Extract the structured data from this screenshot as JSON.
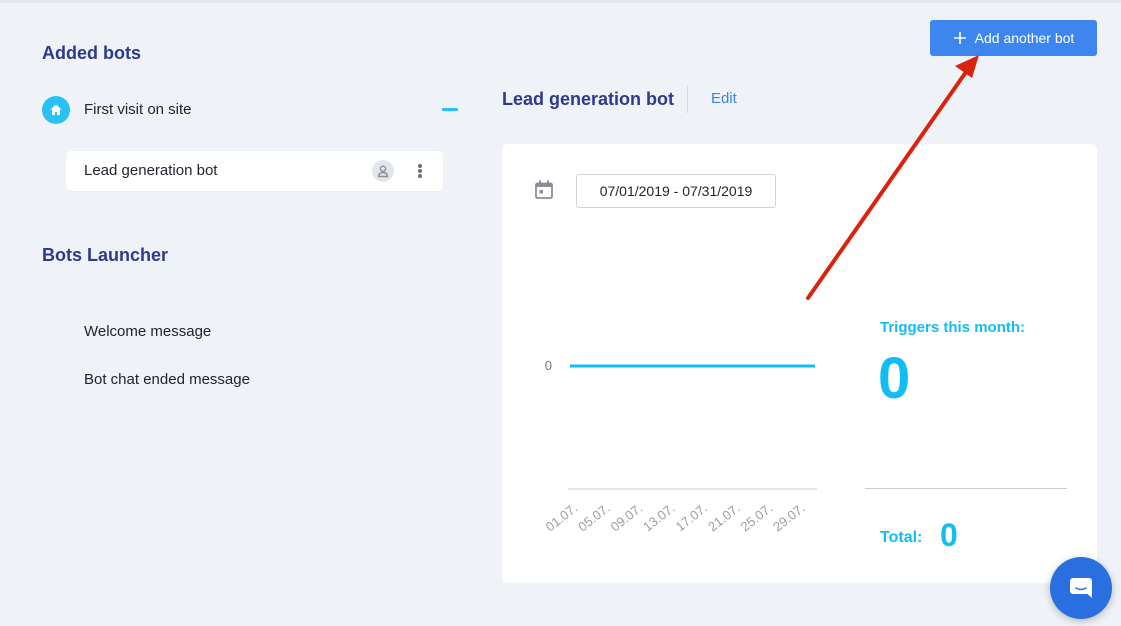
{
  "sidebar": {
    "added_title": "Added bots",
    "group": {
      "label": "First visit on site",
      "icon": "home-icon"
    },
    "bots": [
      {
        "label": "Lead generation bot",
        "icon": "user-icon"
      }
    ],
    "launcher_title": "Bots Launcher",
    "launcher_items": [
      "Welcome message",
      "Bot chat ended message"
    ]
  },
  "header": {
    "bot_title": "Lead generation bot",
    "edit_label": "Edit",
    "add_button_label": "Add another bot"
  },
  "stats": {
    "date_range": "07/01/2019 - 07/31/2019",
    "triggers_label": "Triggers this month:",
    "triggers_value": "0",
    "total_label": "Total:",
    "total_value": "0"
  },
  "colors": {
    "accent": "#12bdf1",
    "brand": "#2c3a8c",
    "button": "#3d86ef",
    "annotation_arrow": "#d9230f"
  },
  "chart_data": {
    "type": "line",
    "categories": [
      "01.07.",
      "05.07.",
      "09.07.",
      "13.07.",
      "17.07.",
      "21.07.",
      "25.07.",
      "29.07."
    ],
    "series": [
      {
        "values": [
          0,
          0,
          0,
          0,
          0,
          0,
          0,
          0
        ]
      }
    ],
    "y_ticks": [
      "0"
    ],
    "title": "",
    "xlabel": "",
    "ylabel": "",
    "grid": false
  }
}
